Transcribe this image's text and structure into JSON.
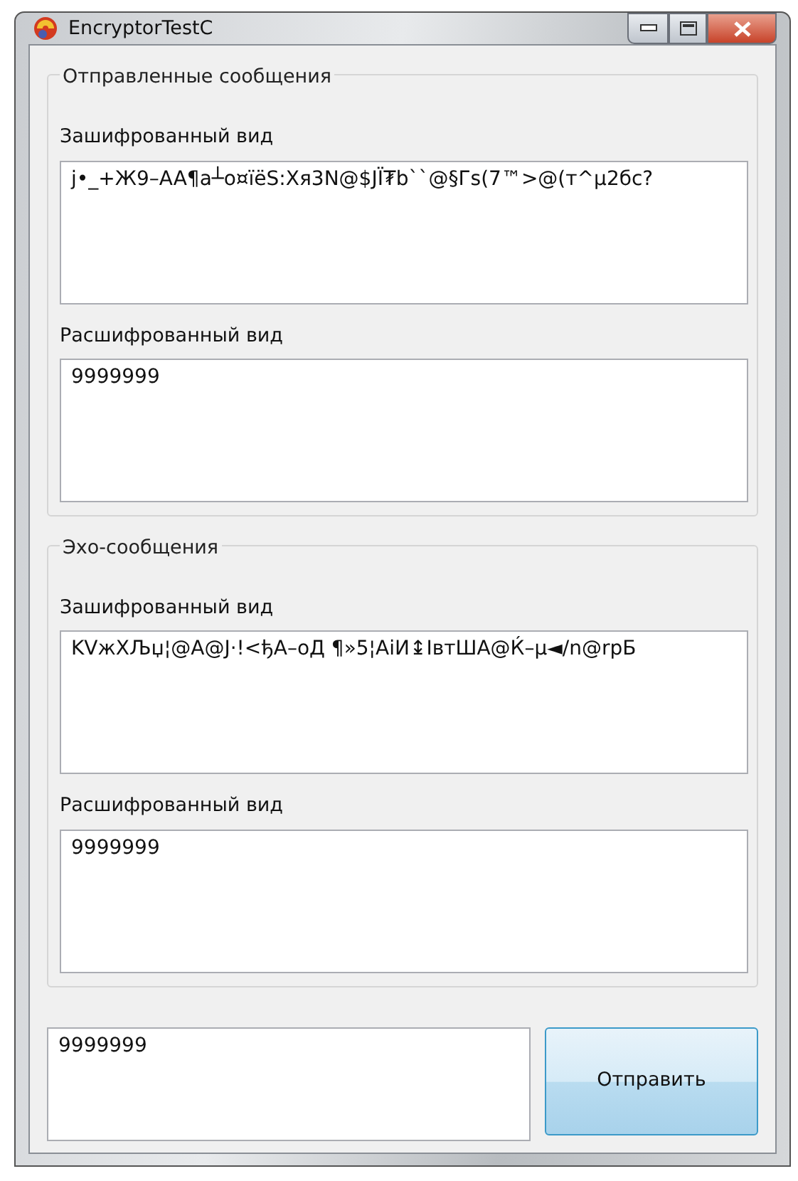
{
  "window": {
    "title": "EncryptorTestC"
  },
  "groups": [
    {
      "title": "Отправленные сообщения",
      "encrypted_label": "Зашифрованный вид",
      "encrypted": "j•_+Ж9–AA¶a┴o¤ïëS:Xя3N@$JЇ₮b``@§Гs(7™>@(т^µ2бc?",
      "decrypted_label": "Расшифрованный вид",
      "decrypted": "9999999"
    },
    {
      "title": "Эхо-сообщения",
      "encrypted_label": "Зашифрованный вид",
      "encrypted": "KVжXЉџ¦@A@J·!<ђA–oД ¶»5¦AiИ↨IвтШA@Ќ–µ◄/n@rpБ",
      "decrypted_label": "Расшифрованный вид",
      "decrypted": "9999999"
    }
  ],
  "message": {
    "value": "9999999"
  },
  "send_button": "Отправить"
}
